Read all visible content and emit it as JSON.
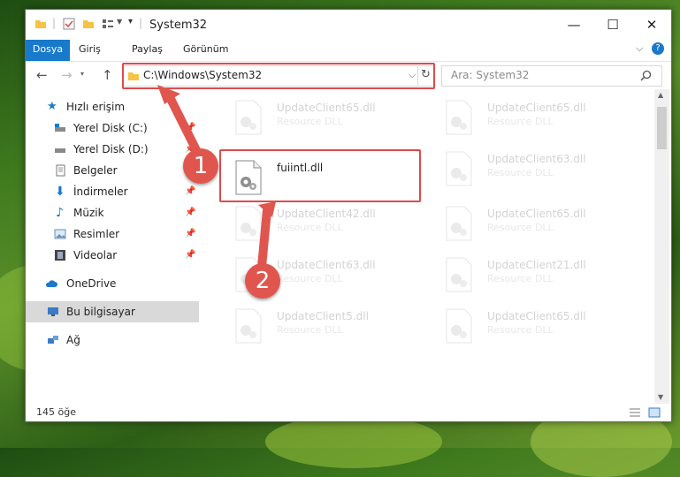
{
  "window": {
    "title": "System32"
  },
  "ribbon": {
    "tabs": [
      "Dosya",
      "Giriş",
      "Paylaş",
      "Görünüm"
    ]
  },
  "address": {
    "path": "C:\\Windows\\System32"
  },
  "search": {
    "placeholder": "Ara: System32"
  },
  "sidebar": {
    "items": [
      {
        "label": "Hızlı erişim"
      },
      {
        "label": "Yerel Disk (C:)"
      },
      {
        "label": "Yerel Disk (D:)"
      },
      {
        "label": "Belgeler"
      },
      {
        "label": "İndirmeler"
      },
      {
        "label": "Müzik"
      },
      {
        "label": "Resimler"
      },
      {
        "label": "Videolar"
      },
      {
        "label": "OneDrive"
      },
      {
        "label": "Bu bilgisayar"
      },
      {
        "label": "Ağ"
      }
    ]
  },
  "files": [
    {
      "name": "UpdateClient65.dll",
      "desc": "Resource DLL"
    },
    {
      "name": "UpdateClient65.dll",
      "desc": "Resource DLL"
    },
    {
      "name": "fuiintl.dll",
      "desc": ""
    },
    {
      "name": "UpdateClient63.dll",
      "desc": "Resource DLL"
    },
    {
      "name": "UpdateClient42.dll",
      "desc": "Resource DLL"
    },
    {
      "name": "UpdateClient65.dll",
      "desc": "Resource DLL"
    },
    {
      "name": "UpdateClient63.dll",
      "desc": "Resource DLL"
    },
    {
      "name": "UpdateClient21.dll",
      "desc": "Resource DLL"
    },
    {
      "name": "UpdateClient5.dll",
      "desc": "Resource DLL"
    },
    {
      "name": "UpdateClient65.dll",
      "desc": "Resource DLL"
    }
  ],
  "status": {
    "count": "145 öğe"
  },
  "annotations": {
    "step1": "1",
    "step2": "2"
  },
  "colors": {
    "accent": "#1979ca",
    "highlight": "#e04a4a"
  }
}
